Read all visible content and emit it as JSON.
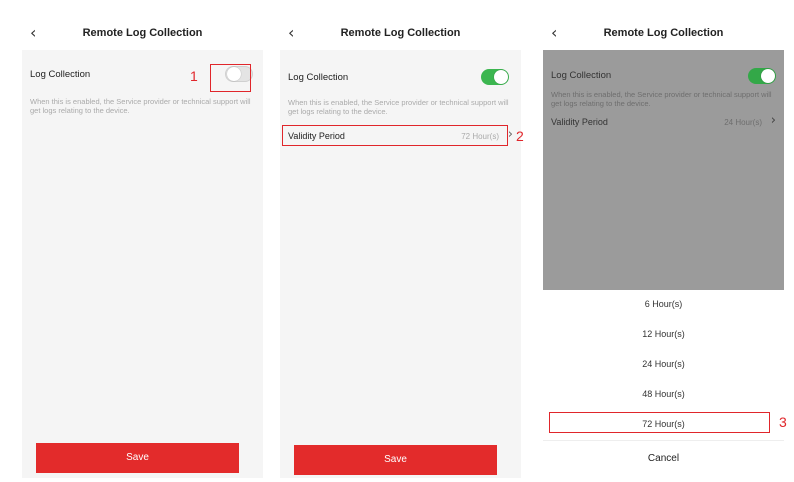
{
  "colors": {
    "accent_red": "#e32b2b",
    "toggle_on": "#3cb650",
    "highlight_box": "#e0262b"
  },
  "screen1": {
    "back_icon": "‹",
    "title": "Remote Log Collection",
    "log_collection_label": "Log Collection",
    "toggle_state": "off",
    "description": "When this is enabled, the Service provider or technical support will get logs relating to the device.",
    "save_label": "Save",
    "step_number": "1"
  },
  "screen2": {
    "back_icon": "‹",
    "title": "Remote Log Collection",
    "log_collection_label": "Log Collection",
    "toggle_state": "on",
    "description": "When this is enabled, the Service provider or technical support will get logs relating to the device.",
    "validity_label": "Validity Period",
    "validity_value": "72 Hour(s)",
    "chevron_icon": "›",
    "save_label": "Save",
    "step_number": "2"
  },
  "screen3": {
    "back_icon": "‹",
    "title": "Remote Log Collection",
    "log_collection_label": "Log Collection",
    "toggle_state": "on",
    "description": "When this is enabled, the Service provider or technical support will get logs relating to the device.",
    "validity_label": "Validity Period",
    "validity_value": "24 Hour(s)",
    "chevron_icon": "›",
    "options": [
      "6 Hour(s)",
      "12 Hour(s)",
      "24 Hour(s)",
      "48 Hour(s)",
      "72 Hour(s)"
    ],
    "selected_option": "72 Hour(s)",
    "cancel_label": "Cancel",
    "step_number": "3"
  }
}
